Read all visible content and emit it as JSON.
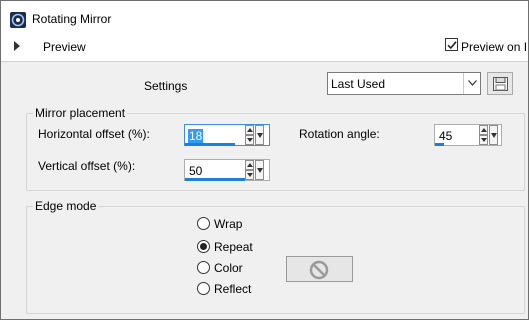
{
  "window": {
    "title": "Rotating Mirror",
    "preview_label": "Preview",
    "preview_on_label": "Preview on I",
    "preview_on_checked": true
  },
  "settings": {
    "label": "Settings",
    "preset_value": "Last Used"
  },
  "mirror_placement": {
    "title": "Mirror placement",
    "horizontal_offset": {
      "label": "Horizontal offset (%):",
      "value": "18"
    },
    "vertical_offset": {
      "label": "Vertical offset (%):",
      "value": "50"
    },
    "rotation_angle": {
      "label": "Rotation angle:",
      "value": "45"
    }
  },
  "edge_mode": {
    "title": "Edge mode",
    "options": [
      {
        "label": "Wrap",
        "checked": false
      },
      {
        "label": "Repeat",
        "checked": true
      },
      {
        "label": "Color",
        "checked": false
      },
      {
        "label": "Reflect",
        "checked": false
      }
    ]
  },
  "colors": {
    "slider_fill": "#1e7fd4",
    "selection": "#3399ff",
    "panel_bg": "#f0f0f0"
  },
  "icons": {
    "app": "rotating-mirror-app-icon",
    "save": "floppy-disk-icon",
    "color_disabled": "no-color-icon"
  }
}
